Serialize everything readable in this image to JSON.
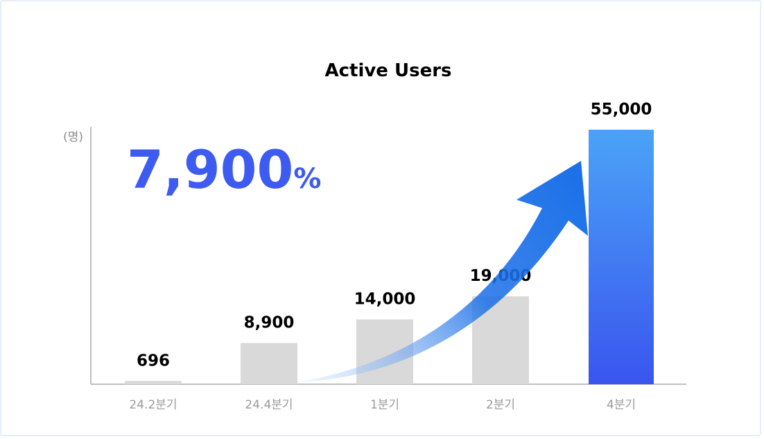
{
  "colors": {
    "bar_default": "#d9d9d9",
    "bar_highlight_top": "#4aa3f7",
    "bar_highlight_bottom": "#3a55ee",
    "growth_text": "#3d5bf0",
    "axis": "#bfbfbf",
    "arrow_start": "#cfe4fb",
    "arrow_end": "#1a6fe8"
  },
  "chart_data": {
    "type": "bar",
    "title": "Active Users",
    "ylabel": "(명)",
    "xlabel": "",
    "categories": [
      "24.2분기",
      "24.4분기",
      "1분기",
      "2분기",
      "4분기"
    ],
    "values": [
      696,
      8900,
      14000,
      19000,
      55000
    ],
    "value_labels": [
      "696",
      "8,900",
      "14,000",
      "19,000",
      "55,000"
    ],
    "highlight_index": 4,
    "ylim": [
      0,
      55000
    ],
    "grid": false,
    "legend": "none",
    "annotation": {
      "number": "7,900",
      "suffix": "%"
    }
  }
}
